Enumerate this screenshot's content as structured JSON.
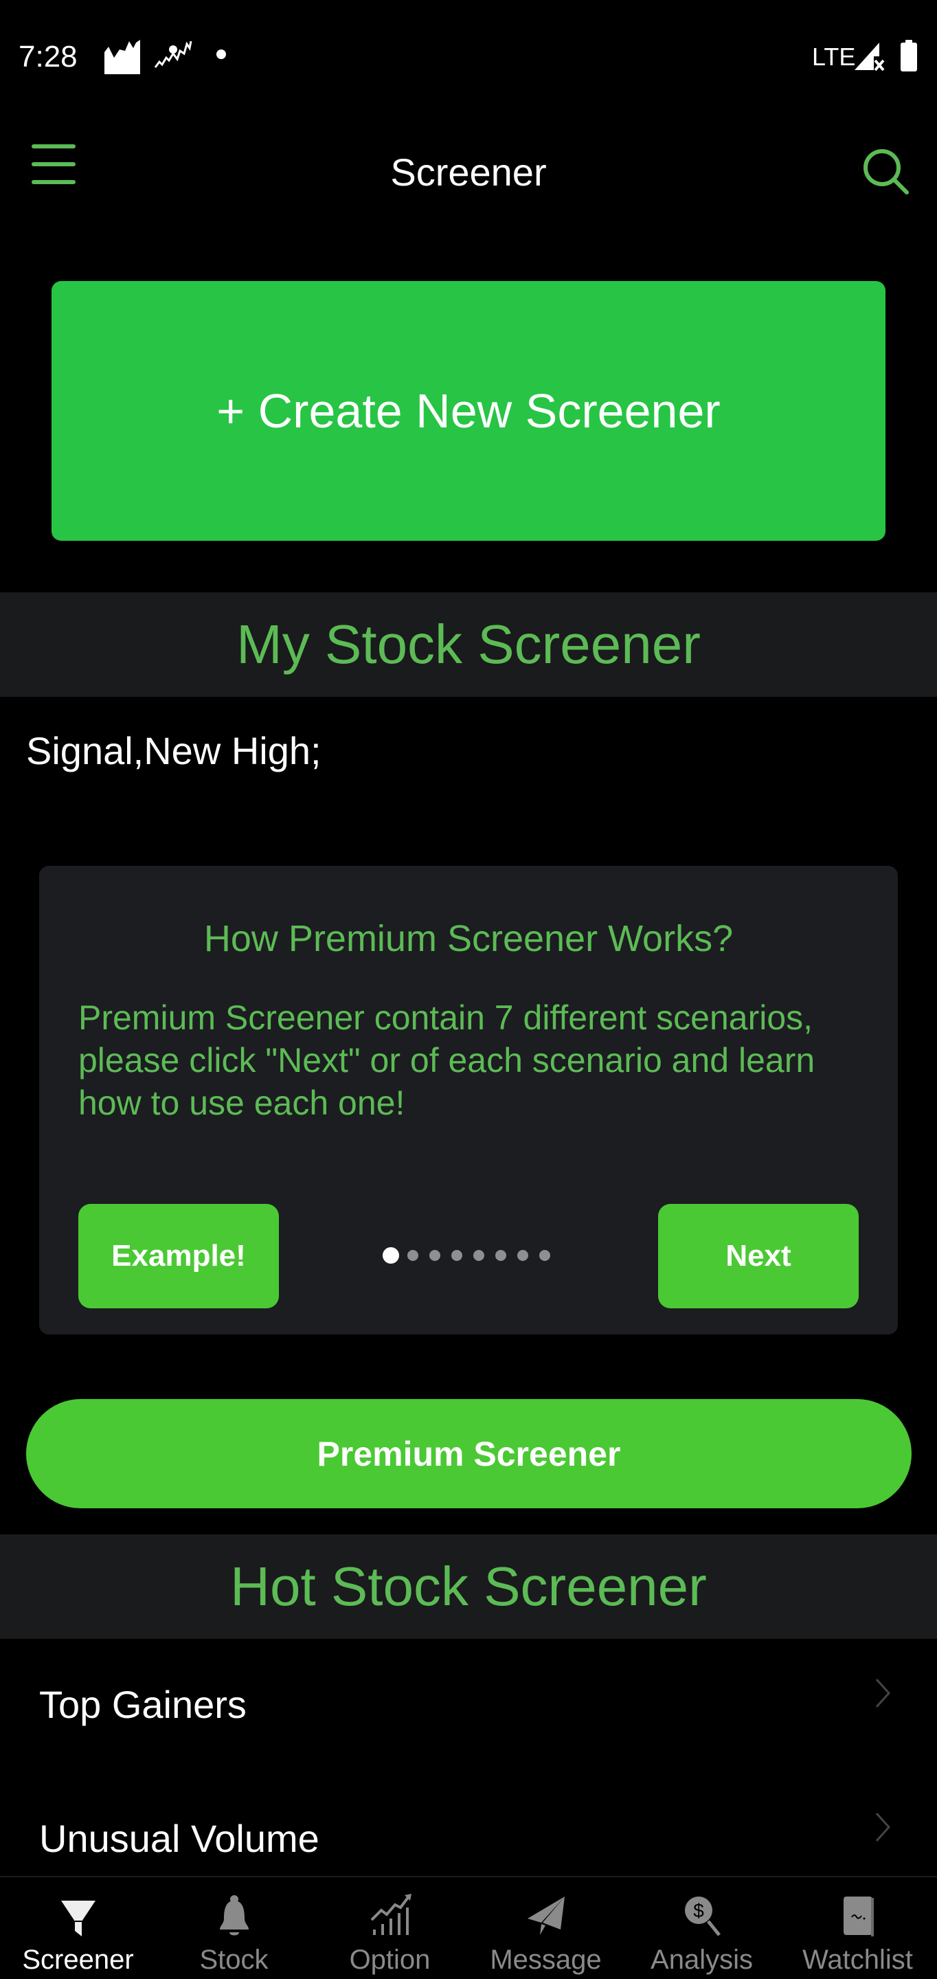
{
  "status_bar": {
    "time": "7:28",
    "network": "LTE",
    "icons": [
      "stock-chart-app-icon",
      "stock-trend-app-icon",
      "notification-dot-icon",
      "signal-no-service-icon",
      "battery-full-icon"
    ]
  },
  "app_bar": {
    "title": "Screener",
    "left_icon": "hamburger-menu-icon",
    "right_icon": "search-icon"
  },
  "create_button": {
    "label": "+ Create New Screener"
  },
  "my_screener": {
    "header": "My Stock Screener",
    "criteria": "Signal,New High;"
  },
  "premium_card": {
    "title": "How Premium Screener Works?",
    "body": "Premium Screener contain 7 different scenarios, please click \"Next\" or of each scenario and learn how to use each one!",
    "example_label": "Example!",
    "next_label": "Next",
    "page_count": 8,
    "current_page": 1
  },
  "premium_button": {
    "label": "Premium Screener"
  },
  "hot_screener": {
    "header": "Hot Stock Screener",
    "items": [
      {
        "label": "Top Gainers"
      },
      {
        "label": "Unusual Volume"
      }
    ]
  },
  "bottom_nav": {
    "items": [
      {
        "label": "Screener",
        "icon": "filter-funnel-icon",
        "active": true
      },
      {
        "label": "Stock",
        "icon": "bell-icon",
        "active": false
      },
      {
        "label": "Option",
        "icon": "trend-bars-icon",
        "active": false
      },
      {
        "label": "Message",
        "icon": "paper-plane-icon",
        "active": false
      },
      {
        "label": "Analysis",
        "icon": "dollar-search-icon",
        "active": false
      },
      {
        "label": "Watchlist",
        "icon": "notebook-icon",
        "active": false
      }
    ]
  },
  "colors": {
    "accent_green": "#5dbb55",
    "create_button_green": "#27c445",
    "action_green": "#4bc934",
    "section_bg": "#1a1b1d",
    "card_bg": "#1c1d21",
    "inactive_gray": "#8a8a8a"
  }
}
